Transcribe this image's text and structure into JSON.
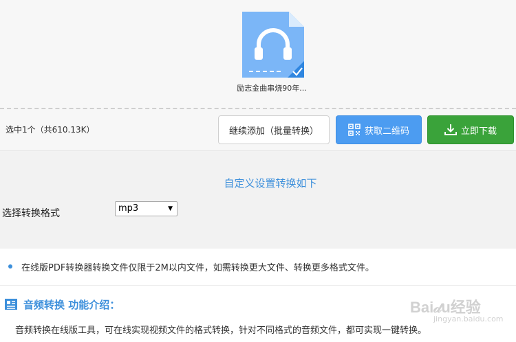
{
  "file": {
    "caption": "励志金曲串烧90年...",
    "icon": "audio-file-headphones-icon",
    "selected": true,
    "accent": "#7bb6f7"
  },
  "action_bar": {
    "selection_info": "选中1个（共610.13K）",
    "continue_label": "继续添加（批量转换）",
    "qr_label": "获取二维码",
    "download_label": "立即下载",
    "qr_color": "#4c9cf1",
    "download_color": "#3aa33a"
  },
  "settings": {
    "title": "自定义设置转换如下",
    "format_label": "选择转换格式",
    "format_value": "mp3"
  },
  "info": {
    "note": "在线版PDF转换器转换文件仅限于2M以内文件，如需转换更大文件、转换更多格式文件。",
    "intro_title": "音频转换 功能介绍：",
    "intro_text": "音频转换在线版工具，可在线实现视频文件的格式转换，针对不同格式的音频文件，都可实现一键转换。"
  },
  "watermark": {
    "brand": "Bai𝒹u经验",
    "sub": "jingyan.baidu.com"
  }
}
